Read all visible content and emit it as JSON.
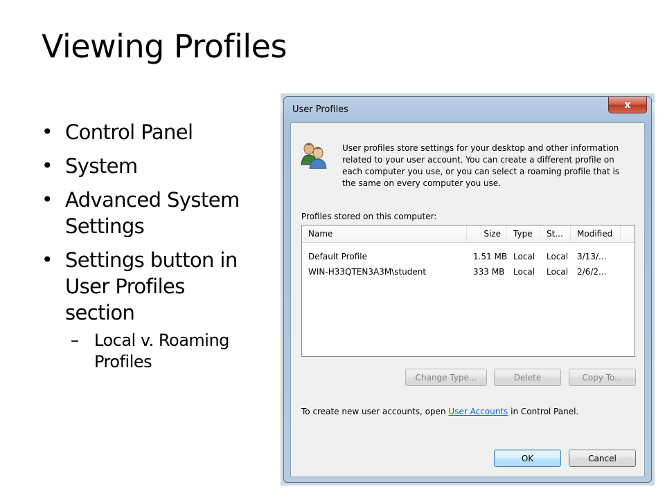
{
  "slide": {
    "title": "Viewing Profiles",
    "bullets": [
      "Control Panel",
      "System",
      "Advanced System Settings",
      "Settings button in User Profiles section"
    ],
    "sub_bullets": [
      "Local v. Roaming Profiles"
    ]
  },
  "dialog": {
    "title": "User Profiles",
    "close_symbol": "x",
    "icon": "users-icon",
    "info": "User profiles store settings for your desktop and other information related to your user account. You can create a different profile on each computer you use, or you can select a roaming profile that is the same on every computer you use.",
    "stored_label": "Profiles stored on this computer:",
    "columns": [
      "Name",
      "Size",
      "Type",
      "St...",
      "Modified"
    ],
    "rows": [
      {
        "name": "Default Profile",
        "size": "1.51 MB",
        "type": "Local",
        "status": "Local",
        "modified": "3/13/..."
      },
      {
        "name": "WIN-H33QTEN3A3M\\student",
        "size": "333 MB",
        "type": "Local",
        "status": "Local",
        "modified": "2/6/2..."
      }
    ],
    "buttons": {
      "change_type": "Change Type...",
      "delete": "Delete",
      "copy_to": "Copy To...",
      "ok": "OK",
      "cancel": "Cancel"
    },
    "footer": {
      "before": "To create new user accounts, open ",
      "link": "User Accounts",
      "after": " in Control Panel."
    }
  },
  "colors": {
    "link": "#0066cc",
    "close_button": "#c7462d",
    "default_button_border": "#3c7fb1"
  }
}
